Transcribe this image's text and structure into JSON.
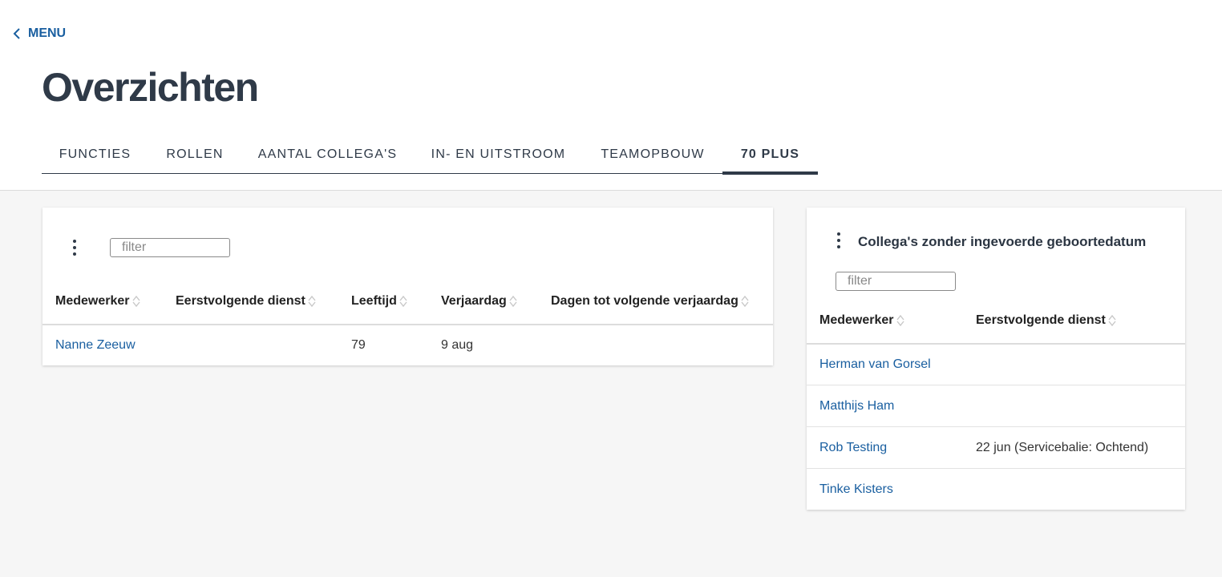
{
  "nav": {
    "back_label": "MENU"
  },
  "page": {
    "title": "Overzichten"
  },
  "tabs": [
    {
      "label": "FUNCTIES",
      "active": false
    },
    {
      "label": "ROLLEN",
      "active": false
    },
    {
      "label": "AANTAL COLLEGA'S",
      "active": false
    },
    {
      "label": "IN- EN UITSTROOM",
      "active": false
    },
    {
      "label": "TEAMOPBOUW",
      "active": false
    },
    {
      "label": "70 PLUS",
      "active": true
    }
  ],
  "seventy_plus": {
    "filter_placeholder": "filter",
    "columns": [
      "Medewerker",
      "Eerstvolgende dienst",
      "Leeftijd",
      "Verjaardag",
      "Dagen tot volgende verjaardag"
    ],
    "rows": [
      {
        "medewerker": "Nanne Zeeuw",
        "dienst": "",
        "leeftijd": "79",
        "verjaardag": "9 aug",
        "dagen": ""
      }
    ]
  },
  "no_birthdate": {
    "title": "Collega's zonder ingevoerde geboortedatum",
    "filter_placeholder": "filter",
    "columns": [
      "Medewerker",
      "Eerstvolgende dienst"
    ],
    "rows": [
      {
        "medewerker": "Herman van Gorsel",
        "dienst": ""
      },
      {
        "medewerker": "Matthijs Ham",
        "dienst": ""
      },
      {
        "medewerker": "Rob Testing",
        "dienst": "22 jun (Servicebalie: Ochtend)"
      },
      {
        "medewerker": "Tinke Kisters",
        "dienst": ""
      }
    ]
  },
  "colors": {
    "accent": "#1a5fa0",
    "heading": "#2f3a48",
    "background": "#f6f6f6"
  }
}
